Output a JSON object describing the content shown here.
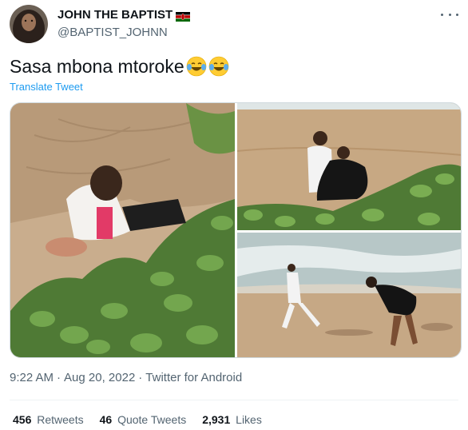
{
  "author": {
    "display_name": "JOHN THE BAPTIST",
    "handle": "@BAPTIST_JOHNN",
    "flag_icon": "kenya-flag-icon"
  },
  "tweet": {
    "text": "Sasa mbona mtoroke",
    "emojis": [
      "face-with-tears-of-joy-emoji",
      "face-with-tears-of-joy-emoji"
    ],
    "translate_label": "Translate Tweet"
  },
  "media": {
    "photos": [
      "photo-man-crouching-in-beach-bushes",
      "photo-couple-sitting-on-sand",
      "photo-couple-running-on-beach"
    ]
  },
  "meta": {
    "time": "9:22 AM",
    "date": "Aug 20, 2022",
    "source": "Twitter for Android",
    "separator": "·"
  },
  "stats": {
    "retweets_count": "456",
    "retweets_label": "Retweets",
    "quotes_count": "46",
    "quotes_label": "Quote Tweets",
    "likes_count": "2,931",
    "likes_label": "Likes"
  },
  "colors": {
    "accent": "#1d9bf0",
    "secondary_text": "#536471",
    "primary_text": "#0f1419"
  }
}
